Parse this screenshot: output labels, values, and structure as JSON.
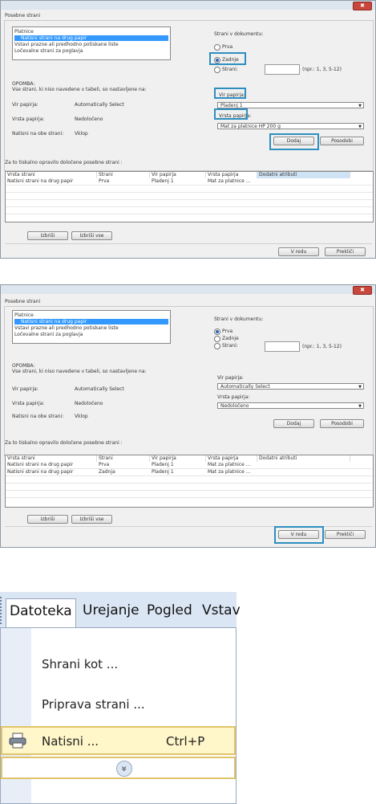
{
  "common": {
    "section_label": "Posebne strani",
    "list_items": [
      "Platnice",
      "Natisni strani na drug papir",
      "Vstavi prazne ali predhodno potiskane liste",
      "Ločevalne strani za poglavja"
    ],
    "doc_pages_label": "Strani v dokumentu:",
    "radio_first": "Prva",
    "radio_last": "Zadnje",
    "radio_pages": "Strani:",
    "pages_hint": "(npr.: 1, 3, 5-12)",
    "note_title": "OPOMBA:",
    "note_text": "Vse strani, ki niso navedene v tabeli, so nastavljene na:",
    "source_label": "Vir papirja:",
    "source_value": "Automatically Select",
    "type_label": "Vrsta papirja:",
    "type_value": "Nedoločeno",
    "duplex_label": "Natisni na obe strani:",
    "duplex_value": "Vklop",
    "right_source_label": "Vir papirja:",
    "right_type_label": "Vrsta papirja:",
    "add_button": "Dodaj",
    "settings_button": "Posodobi",
    "table_caption": "Za to tiskalno opravilo določene posebne strani :",
    "columns": [
      "Vrsta strani",
      "Strani",
      "Vir papirja",
      "Vrsta papirja",
      "Dodatni atributi"
    ],
    "delete_button": "Izbriši",
    "delete_all_button": "Izbriši vse",
    "ok_button": "V redu",
    "cancel_button": "Prekliči",
    "close_glyph": "✖"
  },
  "dialog1": {
    "source_combo": "Pladenj 1",
    "type_combo": "Mat za platnice HP 200 g",
    "rows": [
      [
        "Natisni strani na drug papir",
        "Prva",
        "Pladenj 1",
        "Mat za platnice ...",
        ""
      ]
    ]
  },
  "dialog2": {
    "source_combo": "Automatically Select",
    "type_combo": "Nedoločeno",
    "rows": [
      [
        "Natisni strani na drug papir",
        "Prva",
        "Pladenj 1",
        "Mat za platnice ...",
        ""
      ],
      [
        "Natisni strani na drug papir",
        "Zadnja",
        "Pladenj 1",
        "Mat za platnice ...",
        ""
      ]
    ]
  },
  "menu": {
    "bar": [
      "Datoteka",
      "Urejanje",
      "Pogled",
      "Vstav"
    ],
    "items": [
      "Shrani kot ...",
      "Priprava strani ...",
      "Natisni ...",
      ""
    ],
    "print_shortcut": "Ctrl+P",
    "expand_glyph": "»"
  },
  "colors": {
    "highlight": "#2e8fbf",
    "selection": "#3399ff",
    "menu_highlight": "#fff6c9"
  }
}
